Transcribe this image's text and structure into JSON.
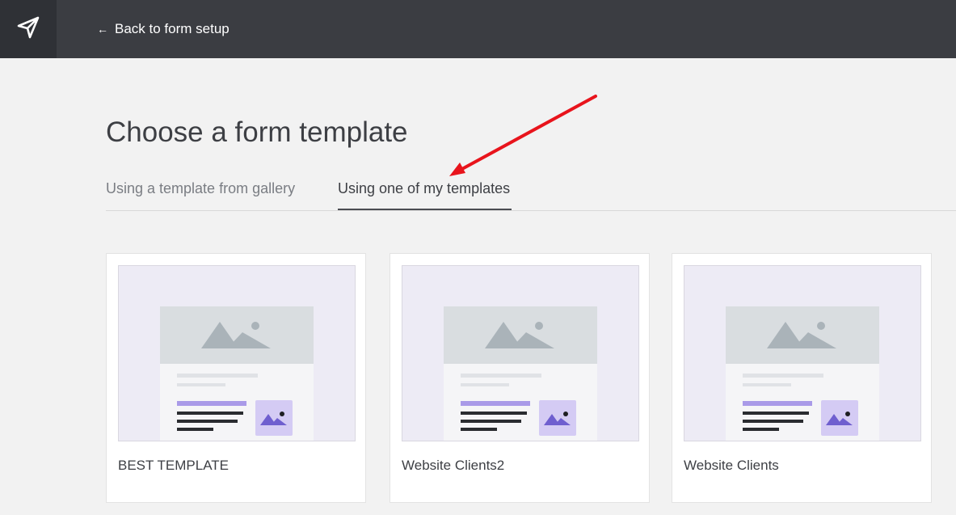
{
  "topbar": {
    "logo_icon": "paper-plane-icon",
    "back_arrow": "←",
    "back_label": "Back to form setup"
  },
  "page": {
    "title": "Choose a form template"
  },
  "tabs": [
    {
      "label": "Using a template from gallery",
      "active": false
    },
    {
      "label": "Using one of my templates",
      "active": true
    }
  ],
  "templates": [
    {
      "name": "BEST TEMPLATE"
    },
    {
      "name": "Website Clients2"
    },
    {
      "name": "Website Clients"
    }
  ],
  "colors": {
    "topbar": "#3b3d42",
    "background": "#f2f2f2",
    "thumbnail_bg": "#edebf5",
    "thumbnail_accent": "#a99ae8",
    "annotation_arrow": "#e8141c"
  },
  "annotation": {
    "type": "red-arrow",
    "points_to": "Using one of my templates"
  }
}
